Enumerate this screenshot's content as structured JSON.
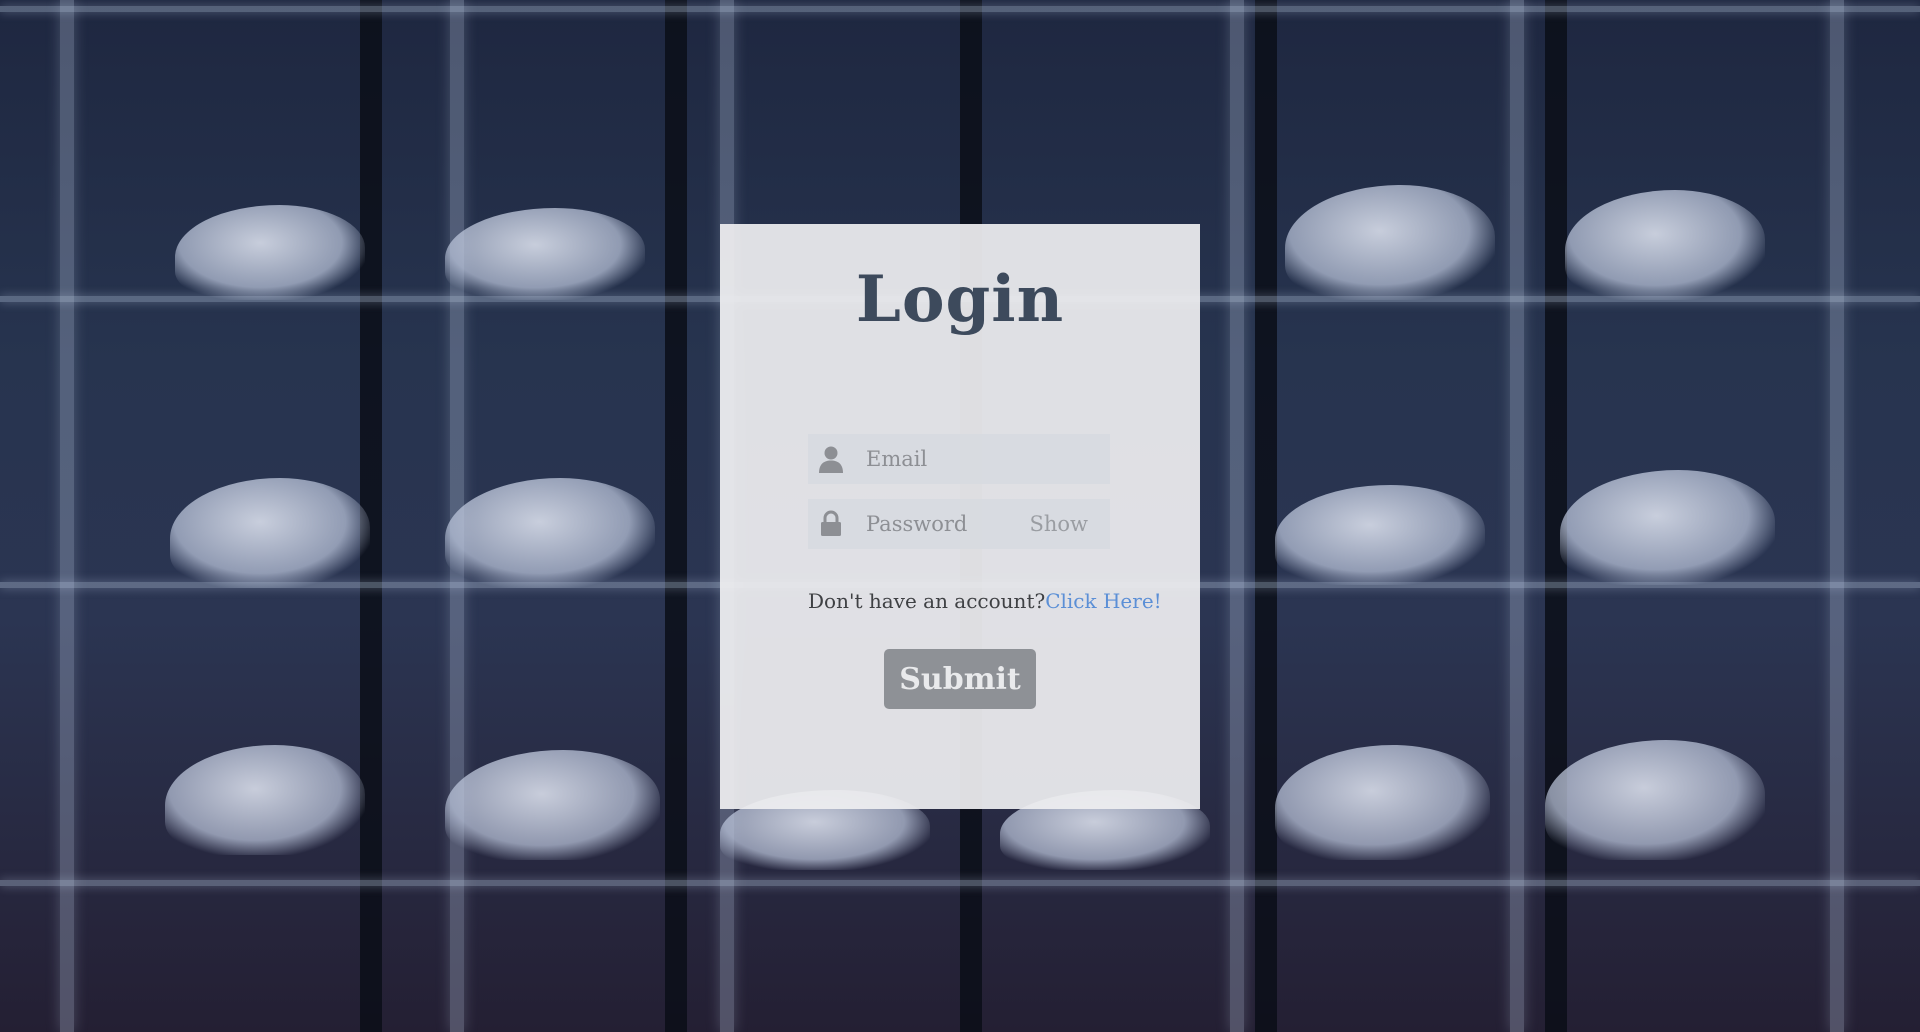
{
  "login_card": {
    "title": "Login",
    "email": {
      "placeholder": "Email",
      "value": "",
      "icon": "user-icon"
    },
    "password": {
      "placeholder": "Password",
      "value": "",
      "icon": "lock-icon",
      "toggle_label": "Show"
    },
    "signup_prompt": "Don't have an account?",
    "signup_link": "Click Here!",
    "submit_label": "Submit"
  },
  "colors": {
    "title": "#3d4a5c",
    "link": "#5b8fd6",
    "submit_bg": "#8e9196",
    "card_bg": "#eeeef0",
    "field_bg": "#d7dae0"
  }
}
